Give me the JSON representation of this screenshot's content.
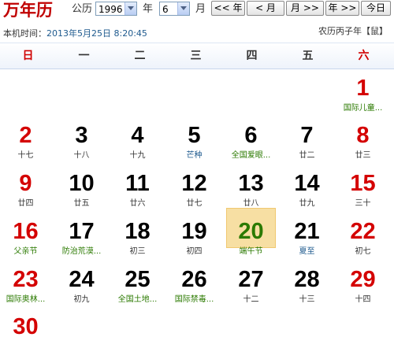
{
  "app": {
    "logo": "万年历"
  },
  "toolbar": {
    "calendar_label": "公历",
    "year_value": "1996",
    "year_label": "年",
    "month_value": "6",
    "month_label": "月",
    "prev_year": "<< 年",
    "prev_month": "< 月",
    "next_month": "月 >>",
    "next_year": "年 >>",
    "today": "今日"
  },
  "info": {
    "local_time_label": "本机时间：",
    "local_time": "2013年5月25日 8:20:45",
    "lunar_year": "农历丙子年【鼠】"
  },
  "weekdays": [
    "日",
    "一",
    "二",
    "三",
    "四",
    "五",
    "六"
  ],
  "days": [
    {
      "d": "1",
      "sub": "国际儿童...",
      "col": 6,
      "row": 0,
      "red": true,
      "subcolor": "green"
    },
    {
      "d": "2",
      "sub": "十七",
      "col": 0,
      "row": 1,
      "red": true
    },
    {
      "d": "3",
      "sub": "十八",
      "col": 1,
      "row": 1
    },
    {
      "d": "4",
      "sub": "十九",
      "col": 2,
      "row": 1
    },
    {
      "d": "5",
      "sub": "芒种",
      "col": 3,
      "row": 1,
      "subcolor": "blue"
    },
    {
      "d": "6",
      "sub": "全国爱眼...",
      "col": 4,
      "row": 1,
      "subcolor": "green"
    },
    {
      "d": "7",
      "sub": "廿二",
      "col": 5,
      "row": 1
    },
    {
      "d": "8",
      "sub": "廿三",
      "col": 6,
      "row": 1,
      "red": true
    },
    {
      "d": "9",
      "sub": "廿四",
      "col": 0,
      "row": 2,
      "red": true
    },
    {
      "d": "10",
      "sub": "廿五",
      "col": 1,
      "row": 2
    },
    {
      "d": "11",
      "sub": "廿六",
      "col": 2,
      "row": 2
    },
    {
      "d": "12",
      "sub": "廿七",
      "col": 3,
      "row": 2
    },
    {
      "d": "13",
      "sub": "廿八",
      "col": 4,
      "row": 2
    },
    {
      "d": "14",
      "sub": "廿九",
      "col": 5,
      "row": 2
    },
    {
      "d": "15",
      "sub": "三十",
      "col": 6,
      "row": 2,
      "red": true
    },
    {
      "d": "16",
      "sub": "父亲节",
      "col": 0,
      "row": 3,
      "red": true,
      "subcolor": "green"
    },
    {
      "d": "17",
      "sub": "防治荒漠...",
      "col": 1,
      "row": 3,
      "subcolor": "green"
    },
    {
      "d": "18",
      "sub": "初三",
      "col": 2,
      "row": 3
    },
    {
      "d": "19",
      "sub": "初四",
      "col": 3,
      "row": 3
    },
    {
      "d": "20",
      "sub": "端午节",
      "col": 4,
      "row": 3,
      "today": true,
      "green": true,
      "subcolor": "green"
    },
    {
      "d": "21",
      "sub": "夏至",
      "col": 5,
      "row": 3,
      "subcolor": "blue"
    },
    {
      "d": "22",
      "sub": "初七",
      "col": 6,
      "row": 3,
      "red": true
    },
    {
      "d": "23",
      "sub": "国际奥林...",
      "col": 0,
      "row": 4,
      "red": true,
      "subcolor": "green"
    },
    {
      "d": "24",
      "sub": "初九",
      "col": 1,
      "row": 4
    },
    {
      "d": "25",
      "sub": "全国土地...",
      "col": 2,
      "row": 4,
      "subcolor": "green"
    },
    {
      "d": "26",
      "sub": "国际禁毒...",
      "col": 3,
      "row": 4,
      "subcolor": "green"
    },
    {
      "d": "27",
      "sub": "十二",
      "col": 4,
      "row": 4
    },
    {
      "d": "28",
      "sub": "十三",
      "col": 5,
      "row": 4
    },
    {
      "d": "29",
      "sub": "十四",
      "col": 6,
      "row": 4,
      "red": true
    },
    {
      "d": "30",
      "sub": "",
      "col": 0,
      "row": 5,
      "red": true
    }
  ]
}
